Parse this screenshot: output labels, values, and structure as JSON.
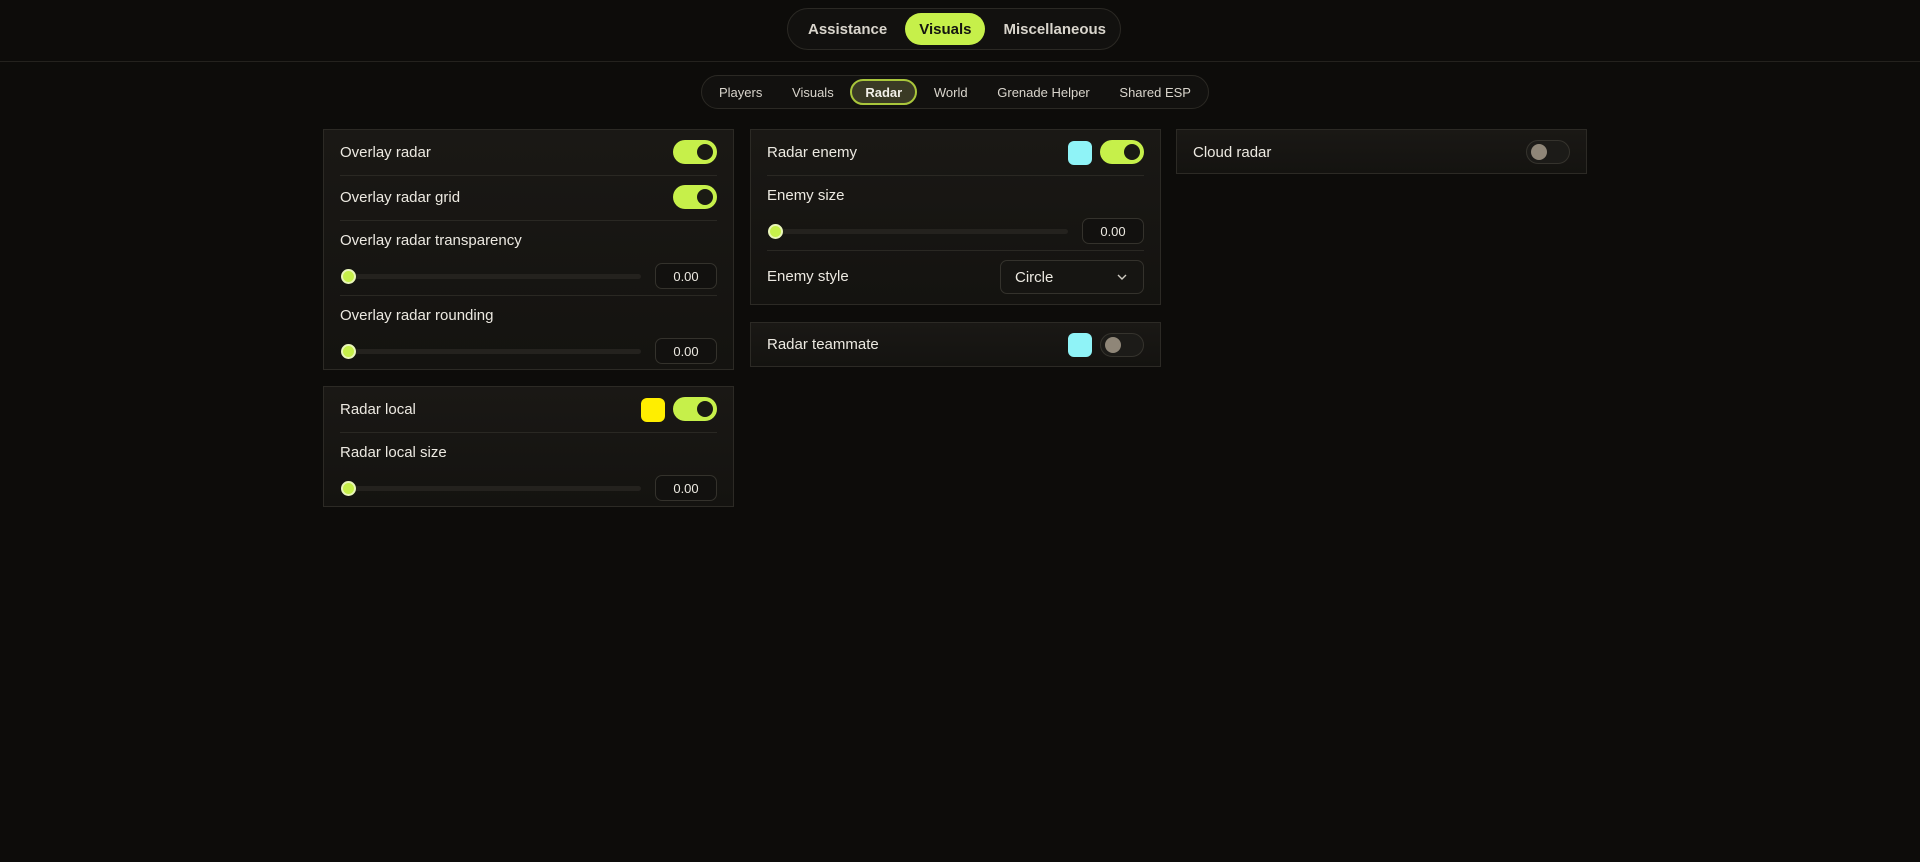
{
  "main_tabs": [
    {
      "label": "Assistance",
      "active": false
    },
    {
      "label": "Visuals",
      "active": true
    },
    {
      "label": "Miscellaneous",
      "active": false
    }
  ],
  "sub_tabs": [
    {
      "label": "Players",
      "active": false
    },
    {
      "label": "Visuals",
      "active": false
    },
    {
      "label": "Radar",
      "active": true
    },
    {
      "label": "World",
      "active": false
    },
    {
      "label": "Grenade Helper",
      "active": false
    },
    {
      "label": "Shared ESP",
      "active": false
    }
  ],
  "overlay_panel": {
    "overlay_radar": {
      "label": "Overlay radar",
      "enabled": true
    },
    "overlay_radar_grid": {
      "label": "Overlay radar grid",
      "enabled": true
    },
    "transparency": {
      "label": "Overlay radar transparency",
      "value": "0.00"
    },
    "rounding": {
      "label": "Overlay radar rounding",
      "value": "0.00"
    }
  },
  "local_panel": {
    "radar_local": {
      "label": "Radar local",
      "enabled": true,
      "color": "#ffee00"
    },
    "local_size": {
      "label": "Radar local size",
      "value": "0.00"
    }
  },
  "enemy_panel": {
    "radar_enemy": {
      "label": "Radar enemy",
      "enabled": true,
      "color": "#8ff3f7"
    },
    "enemy_size": {
      "label": "Enemy size",
      "value": "0.00"
    },
    "enemy_style": {
      "label": "Enemy style",
      "selected": "Circle"
    }
  },
  "teammate_panel": {
    "radar_teammate": {
      "label": "Radar teammate",
      "enabled": false,
      "color": "#8ff3f7"
    }
  },
  "cloud_panel": {
    "cloud_radar": {
      "label": "Cloud radar",
      "enabled": false
    }
  },
  "colors": {
    "accent": "#c6f04a",
    "background": "#0d0c0a"
  }
}
